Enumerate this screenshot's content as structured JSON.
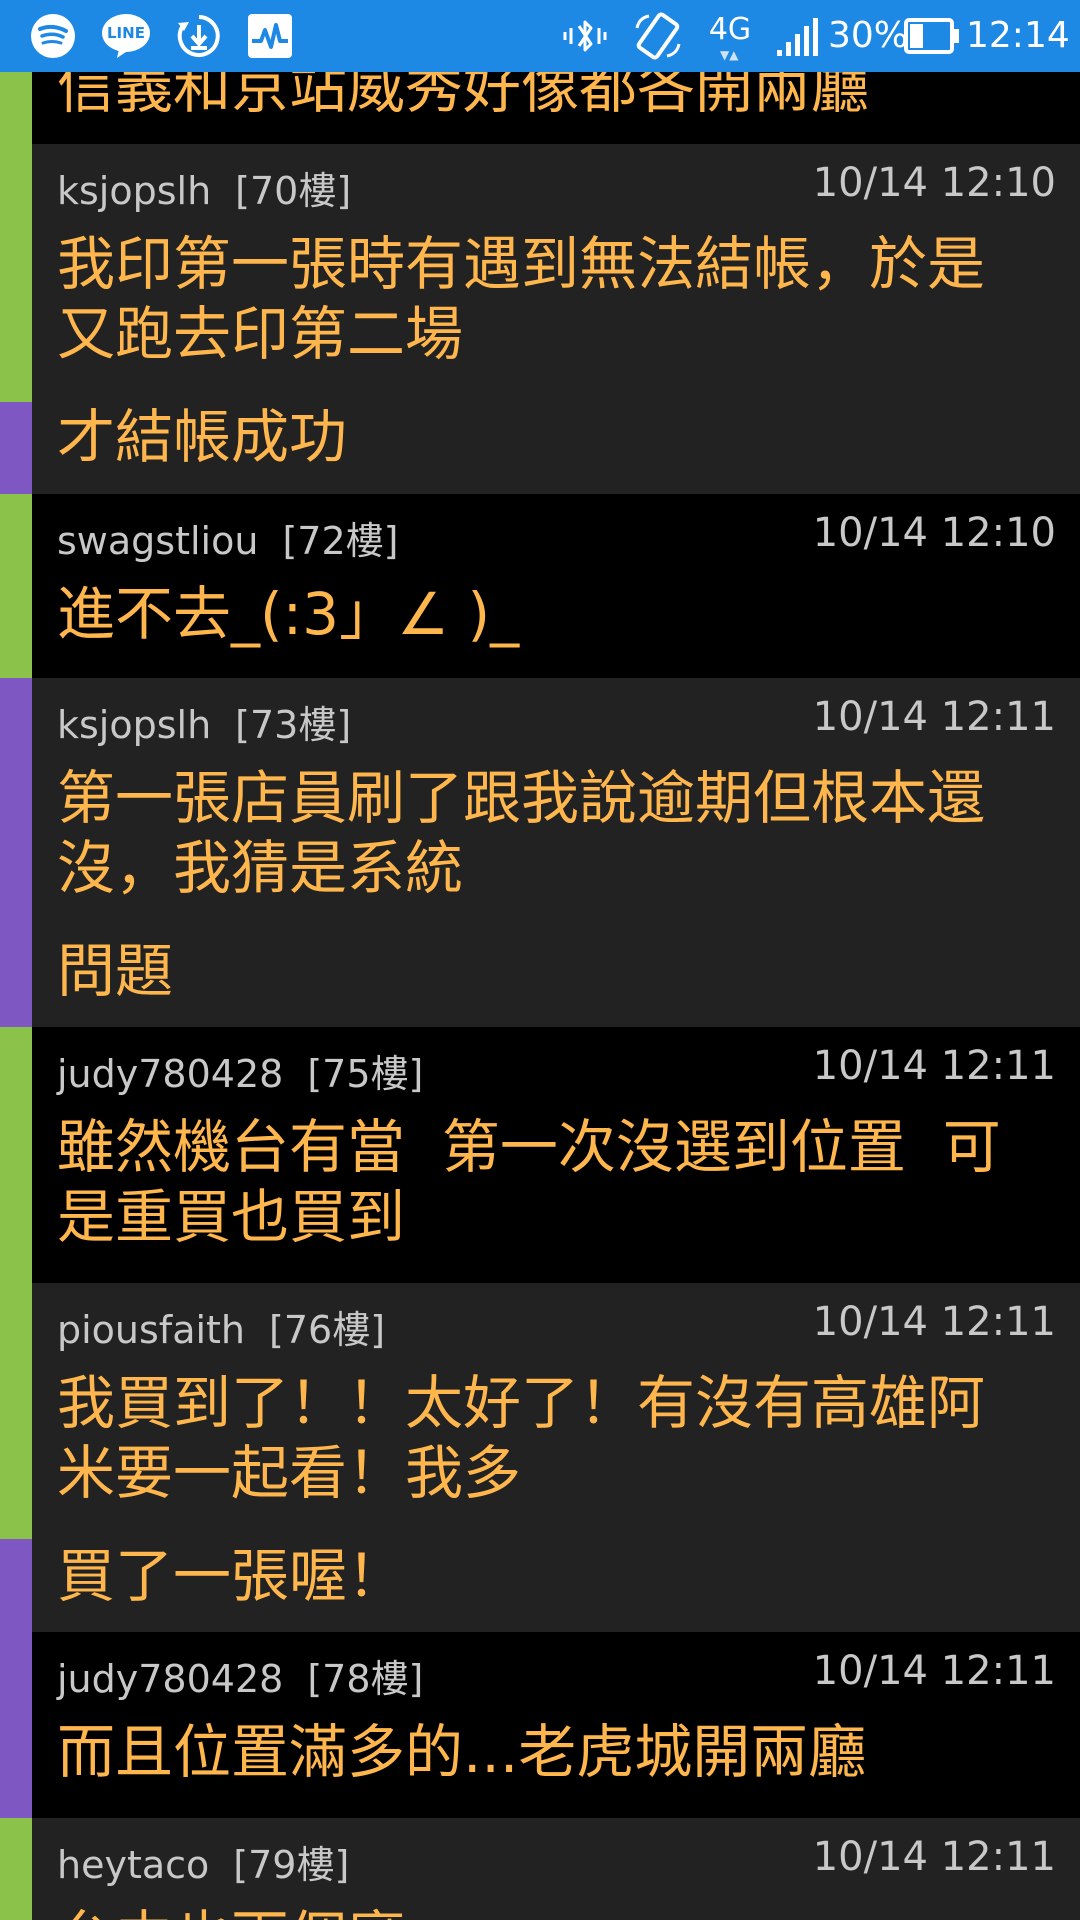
{
  "status_bar": {
    "icons": [
      "spotify-icon",
      "line-icon",
      "sync-download-icon",
      "activity-icon",
      "bluetooth-vibrate-icon",
      "auto-rotate-icon",
      "lte-4g-icon",
      "signal-icon",
      "battery-icon"
    ],
    "line_label": "LINE",
    "network": "4G",
    "battery": "30%",
    "time": "12:14",
    "background": "#1e88e5"
  },
  "colors": {
    "message_text": "#ffb74d",
    "meta_text": "#c8c8c8",
    "bar_green": "#8bc34a",
    "bar_purple": "#7e57c2",
    "row_dark": "#222222",
    "row_black": "#000000"
  },
  "top_fragment": {
    "text": "信義和京站威秀好像都各開兩廳"
  },
  "posts": [
    {
      "author": "ksjopslh",
      "floor": "[70樓]",
      "time": "10/14 12:10",
      "line1": "我印第一張時有遇到無法結帳，於是",
      "line2": "又跑去印第二場",
      "line3": "才結帳成功"
    },
    {
      "author": "swagstliou",
      "floor": "[72樓]",
      "time": "10/14 12:10",
      "line1": "進不去_(:3」∠ )_"
    },
    {
      "author": "ksjopslh",
      "floor": "[73樓]",
      "time": "10/14 12:11",
      "line1": "第一張店員刷了跟我說逾期但根本還",
      "line2": "沒，我猜是系統",
      "line3": "問題"
    },
    {
      "author": "judy780428",
      "floor": "[75樓]",
      "time": "10/14 12:11",
      "line1": "雖然機台有當  第一次沒選到位置  可",
      "line2": "是重買也買到"
    },
    {
      "author": "piousfaith",
      "floor": "[76樓]",
      "time": "10/14 12:11",
      "line1": "我買到了！！太好了！有沒有高雄阿",
      "line2": "米要一起看！我多",
      "line3": "買了一張喔！"
    },
    {
      "author": "judy780428",
      "floor": "[78樓]",
      "time": "10/14 12:11",
      "line1": "而且位置滿多的...老虎城開兩廳"
    },
    {
      "author": "heytaco",
      "floor": "[79樓]",
      "time": "10/14 12:11",
      "line1": "台中也兩個廳"
    }
  ]
}
